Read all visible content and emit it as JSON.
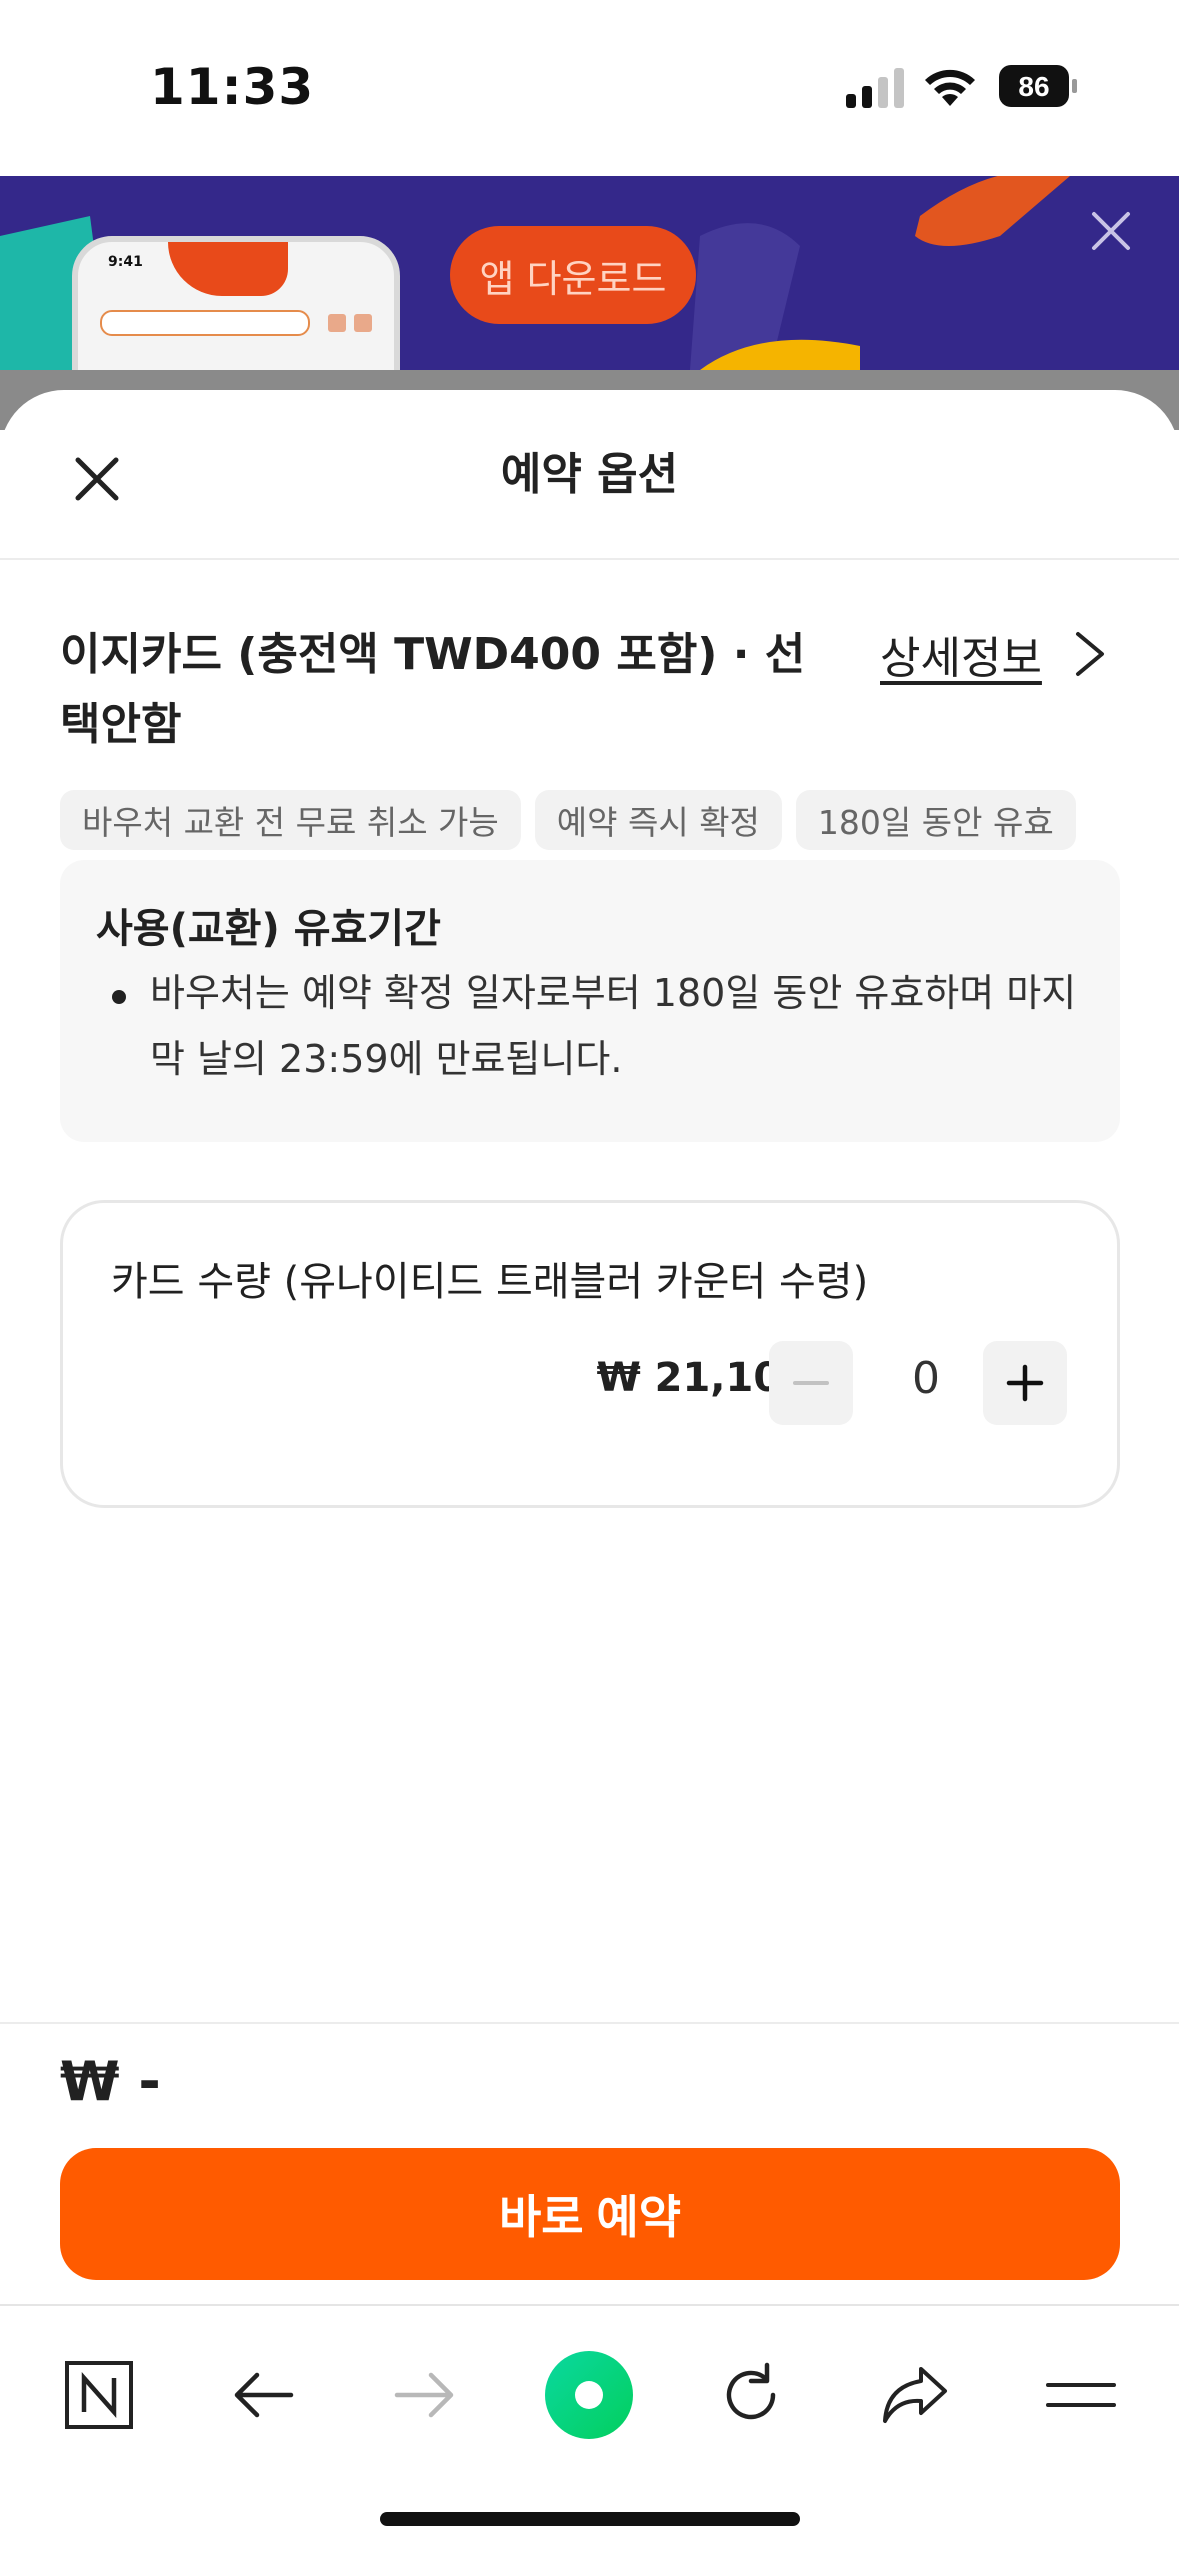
{
  "status_bar": {
    "time": "11:33",
    "battery": "86"
  },
  "banner": {
    "download_label": "앱 다운로드",
    "mockup_time": "9:41"
  },
  "sheet": {
    "title": "예약 옵션"
  },
  "product": {
    "name": "이지카드 (충전액 TWD400 포함) · 선택안함",
    "detail_link": "상세정보"
  },
  "tags": [
    "바우처 교환 전 무료 취소 가능",
    "예약 즉시 확정",
    "180일 동안 유효"
  ],
  "validity": {
    "title": "사용(교환) 유효기간",
    "text": "바우처는 예약 확정 일자로부터 180일 동안 유효하며 마지막 날의 23:59에 만료됩니다."
  },
  "quantity_card": {
    "label": "카드 수량 (유나이티드 트래블러 카운터 수령)",
    "price": "₩ 21,100",
    "quantity": "0"
  },
  "footer": {
    "total": "₩ -",
    "book_label": "바로 예약"
  },
  "browser_bar": {
    "icons": [
      "naver-n-icon",
      "back-arrow-icon",
      "forward-arrow-icon",
      "green-dot-icon",
      "reload-icon",
      "share-icon",
      "menu-icon"
    ]
  },
  "colors": {
    "accent": "#ff5b00",
    "banner_bg": "#34288a",
    "naver_green": "#03cf5d"
  }
}
